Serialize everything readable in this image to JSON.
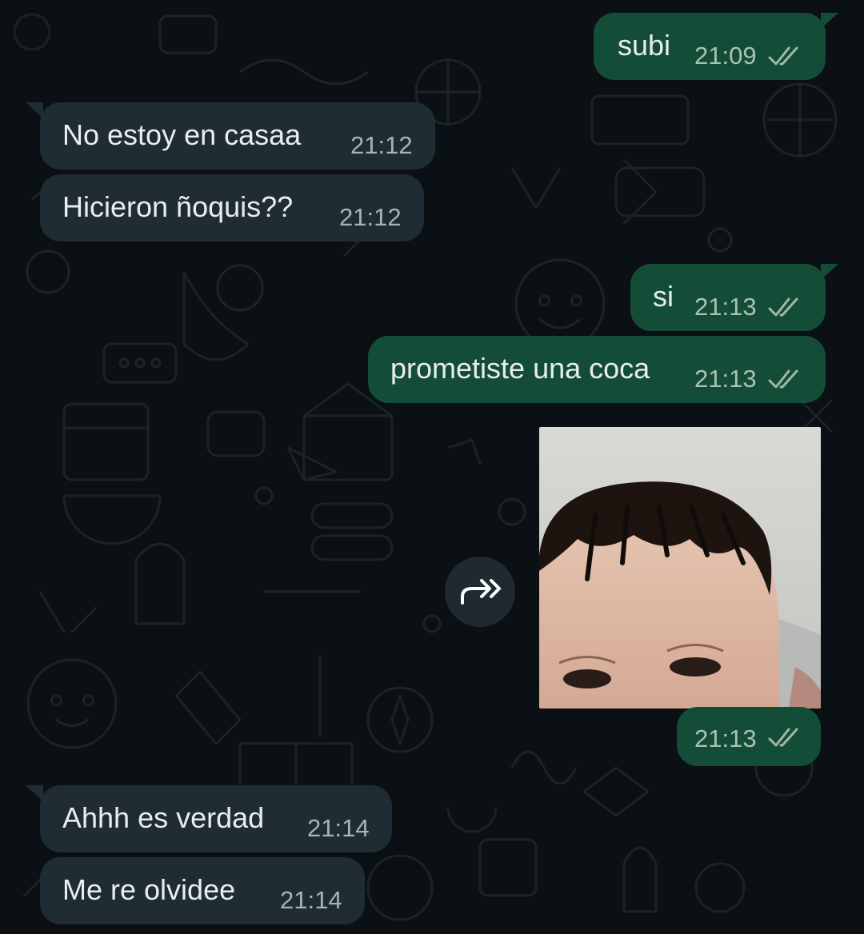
{
  "conversation": {
    "messages": [
      {
        "direction": "out",
        "text": "subi",
        "time": "21:09"
      },
      {
        "direction": "in",
        "text": "No estoy en casaa",
        "time": "21:12"
      },
      {
        "direction": "in",
        "text": "Hicieron ñoquis??",
        "time": "21:12"
      },
      {
        "direction": "out",
        "text": "si",
        "time": "21:13"
      },
      {
        "direction": "out",
        "text": "prometiste una coca",
        "time": "21:13"
      },
      {
        "direction": "out",
        "type": "photo",
        "time": "21:13"
      },
      {
        "direction": "in",
        "text": "Ahhh es verdad",
        "time": "21:14"
      },
      {
        "direction": "in",
        "text": "Me re olvidee",
        "time": "21:14"
      }
    ]
  },
  "icons": {
    "read_receipt": "double-check-icon",
    "forward": "forward-arrow-icon"
  },
  "colors": {
    "background": "#0b1014",
    "incoming_bubble": "#202c33",
    "outgoing_bubble": "#134d37",
    "read_ticks": "#9fb8aa",
    "text": "#e9edef"
  }
}
